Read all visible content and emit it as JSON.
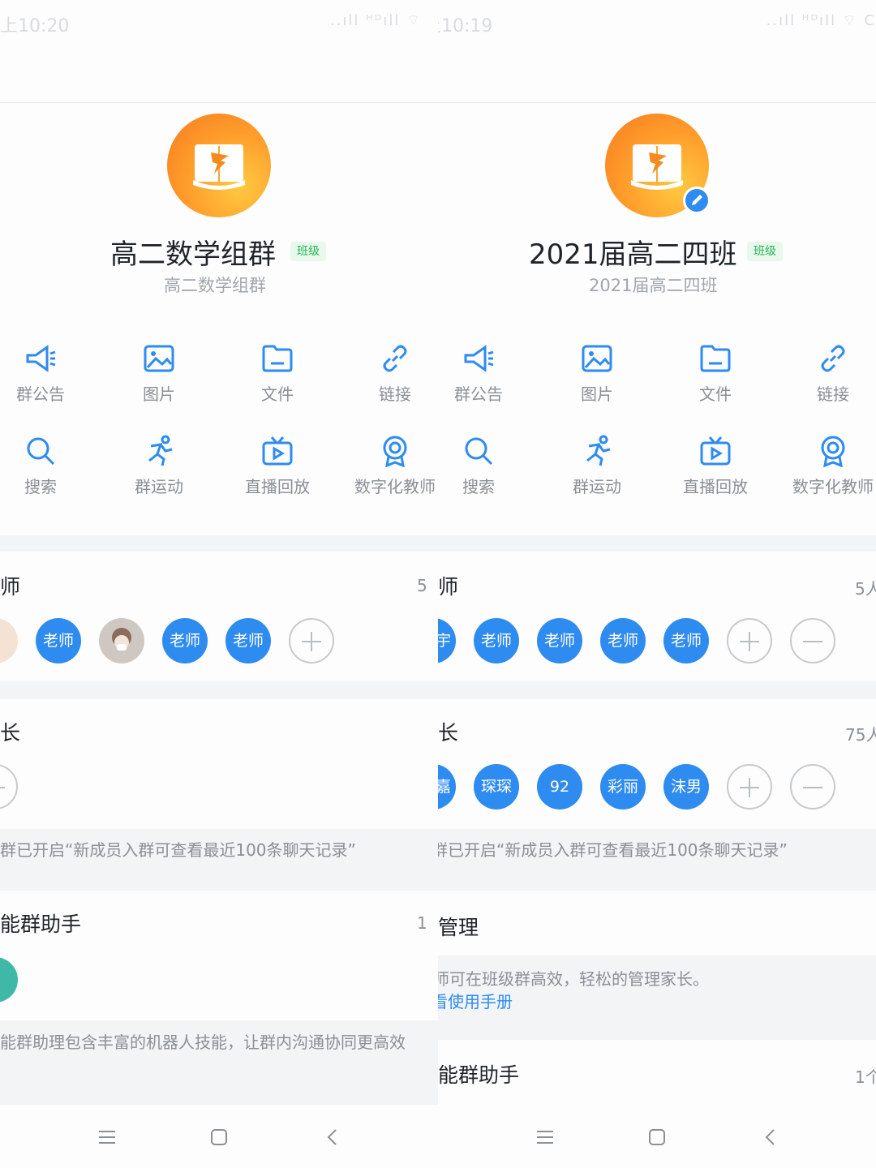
{
  "left": {
    "time": "上10:20",
    "signal": "..ıll ᴴᴰıll ⌔",
    "group_name": "高二数学组群",
    "tag": "班级",
    "group_sub": "高二数学组群",
    "tools": [
      "群公告",
      "图片",
      "文件",
      "链接",
      "搜索",
      "群运动",
      "直播回放",
      "数字化教师"
    ],
    "teacher_title": "师",
    "teacher_count": "5",
    "teacher_members": [
      "老师",
      "老师",
      "老师"
    ],
    "parent_title": "长",
    "notice": "群已开启“新成员入群可查看最近100条聊天记录”",
    "assistant_title": "能群助手",
    "assistant_count": "1",
    "assistant_desc": "能群助理包含丰富的机器人技能，让群内沟通协同更高效"
  },
  "right": {
    "time": "上10:19",
    "signal": "..ıll ᴴᴰıll ⌔ C",
    "group_name": "2021届高二四班",
    "tag": "班级",
    "group_sub": "2021届高二四班",
    "tools": [
      "群公告",
      "图片",
      "文件",
      "链接",
      "搜索",
      "群运动",
      "直播回放",
      "数字化教师"
    ],
    "teacher_title": "师",
    "teacher_count": "5人",
    "teacher_members": [
      "宇",
      "老师",
      "老师",
      "老师",
      "老师"
    ],
    "parent_title": "长",
    "parent_count": "75人",
    "parent_members": [
      "嘉",
      "琛琛",
      "92",
      "彩丽",
      "沫男"
    ],
    "notice": "群已开启“新成员入群可查看最近100条聊天记录”",
    "manage_title": "管理",
    "manage_desc": "师可在班级群高效，轻松的管理家长。",
    "manage_link": "看使用手册",
    "assistant_title": "能群助手",
    "assistant_count": "1个"
  },
  "colors": {
    "accent": "#2e8bf0",
    "tag_bg": "#e8f8ec",
    "tag_text": "#28b556",
    "avatar_orange": "#f67a1f",
    "avatar_yellow": "#ffc940"
  }
}
